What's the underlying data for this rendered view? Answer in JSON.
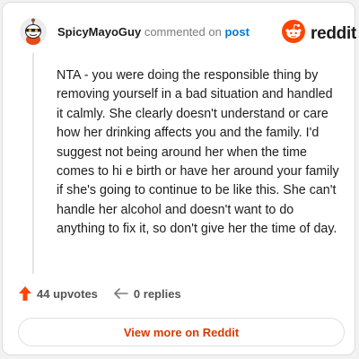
{
  "header": {
    "username": "SpicyMayoGuy",
    "action_text": "commented on",
    "link_text": "post",
    "avatar_icon": "snoo-avatar-icon"
  },
  "brand": {
    "logo_icon": "reddit-logo-icon",
    "name": "reddit",
    "color": "#ff4500"
  },
  "comment": {
    "text": "NTA - you were doing the responsible thing by removing yourself in a bad situation and handled it calmly. She clearly doesn't understand or care how her drinking affects you and the family. I'd suggest not being around her when the time comes to hi e birth or have her around your family if she's going to continue to be like this. She can't handle her alcohol and doesn't want to do anything to fix it, so don't give her the time of day."
  },
  "actions": {
    "upvote_icon": "upvote-arrow-icon",
    "upvotes_label": "44 upvotes",
    "reply_icon": "reply-arrow-icon",
    "replies_label": "0 replies"
  },
  "footer": {
    "view_more_label": "View more on Reddit"
  },
  "colors": {
    "accent": "#ff4500",
    "link": "#0079d3",
    "cta": "#d93a00",
    "muted_text": "#7c7c7c"
  }
}
